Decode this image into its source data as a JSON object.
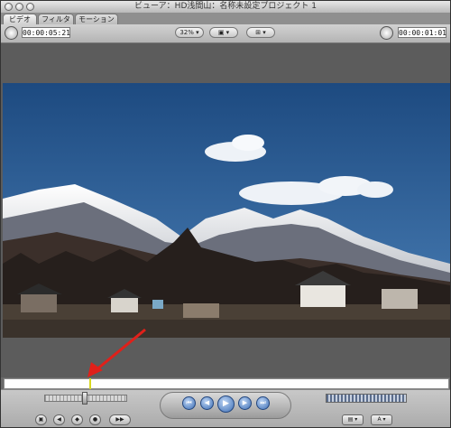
{
  "window": {
    "title": "ビューア：HD浅間山：名称未設定プロジェクト 1"
  },
  "tabs": [
    {
      "label": "ビデオ",
      "active": true
    },
    {
      "label": "フィルタ",
      "active": false
    },
    {
      "label": "モーション",
      "active": false
    }
  ],
  "toolbar": {
    "duration_timecode": "00:00:05:21",
    "zoom": "32%",
    "current_timecode": "00:00:01:01"
  },
  "icons": {
    "duration_dial": "clock-dial-icon",
    "view_menu": "film-view-icon",
    "overlay_menu": "overlay-icon",
    "current_dial": "clock-dial-icon",
    "annotation": "red-arrow-icon"
  },
  "transport": {
    "prev_edit": "⏮",
    "step_back": "◀",
    "play": "▶",
    "step_forward": "▶",
    "next_edit": "⏭"
  },
  "colors": {
    "sky": "#2f5f96",
    "playhead": "#d8d820",
    "arrow": "#e0201a"
  }
}
